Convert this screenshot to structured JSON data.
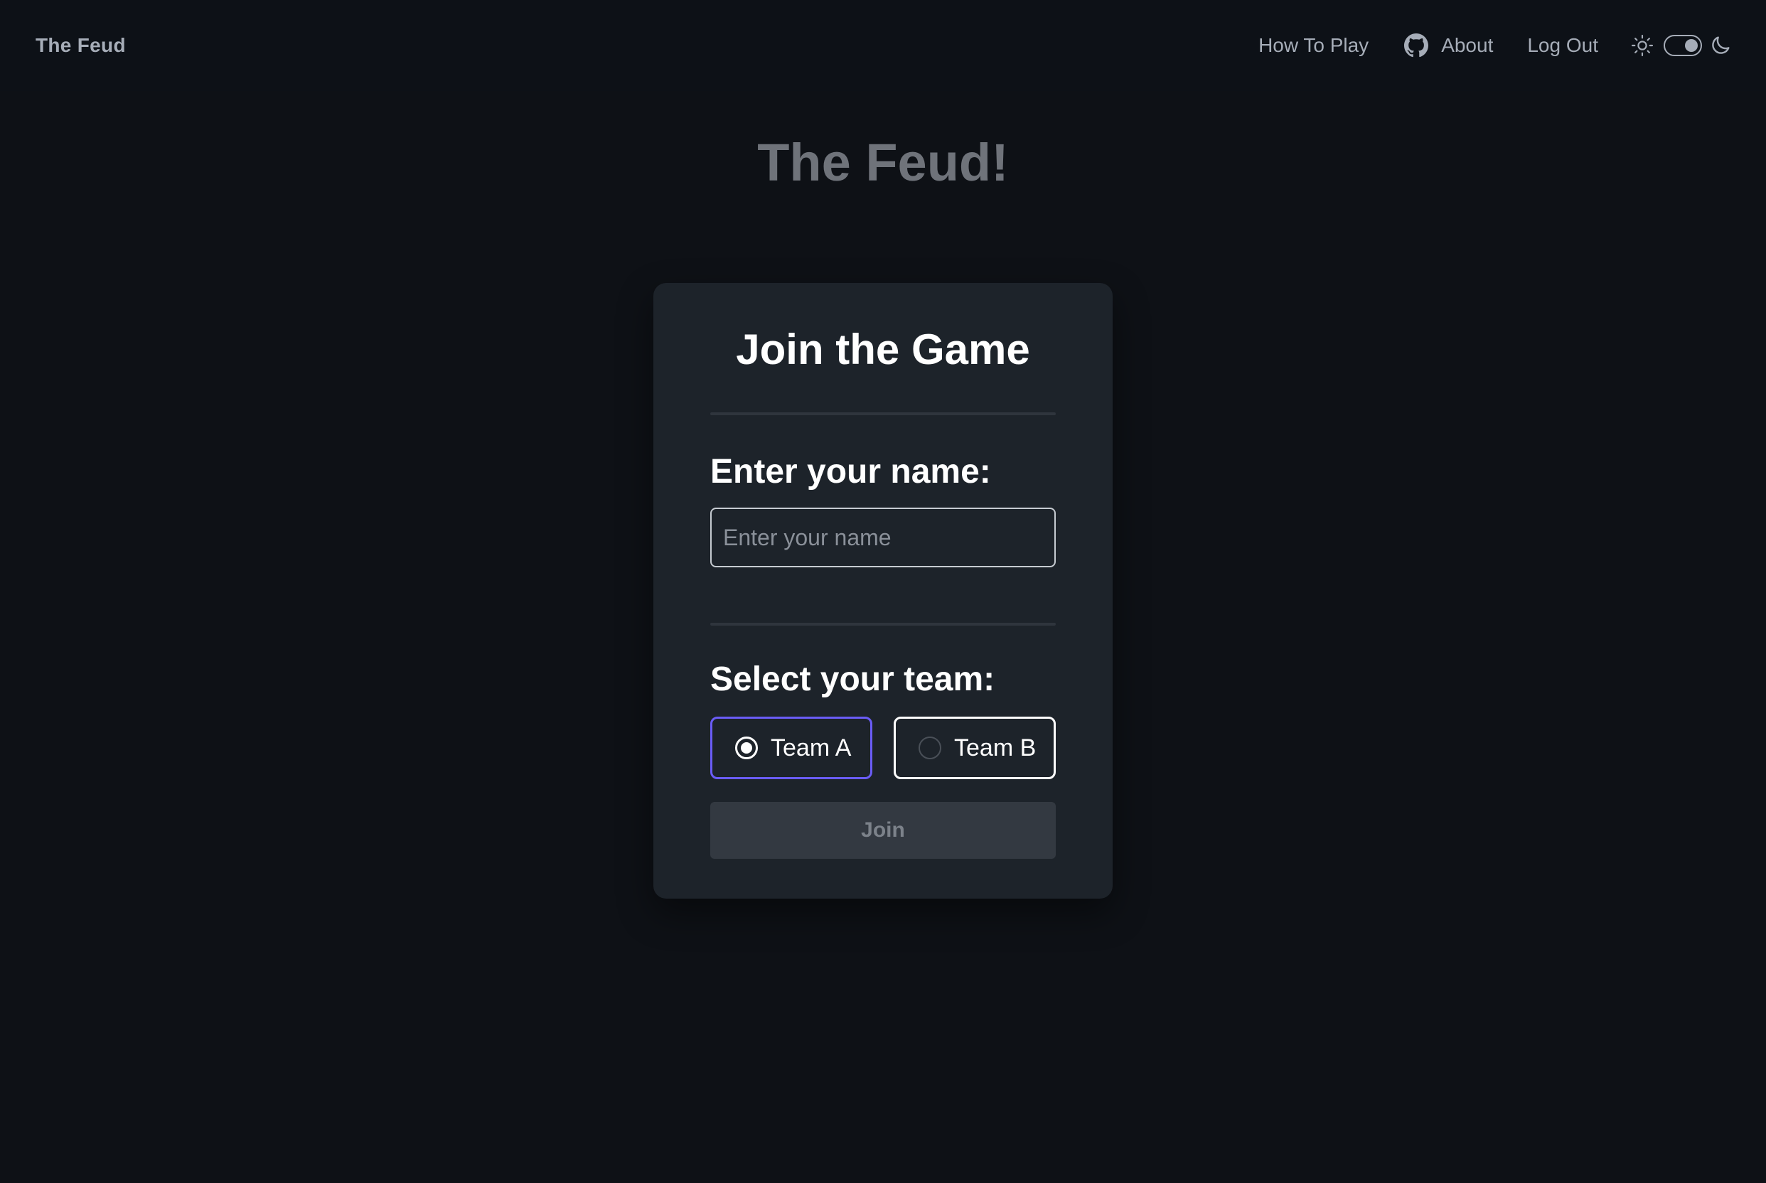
{
  "navbar": {
    "brand": "The Feud",
    "links": {
      "how_to_play": "How To Play",
      "about": "About",
      "logout": "Log Out"
    },
    "icons": {
      "about_icon": "github-icon",
      "light": "sun-icon",
      "dark": "moon-icon"
    },
    "theme_toggle_state": "dark"
  },
  "page": {
    "title": "The Feud!"
  },
  "card": {
    "heading": "Join the Game",
    "name_label": "Enter your name:",
    "name_input": {
      "value": "",
      "placeholder": "Enter your name"
    },
    "team_label": "Select your team:",
    "teams": [
      {
        "label": "Team A",
        "selected": true
      },
      {
        "label": "Team B",
        "selected": false
      }
    ],
    "join_label": "Join",
    "join_disabled": true
  },
  "colors": {
    "background": "#0e1116",
    "card": "#1d232a",
    "accent_selected": "#6a5cf5",
    "muted_text": "#a6adb8"
  }
}
